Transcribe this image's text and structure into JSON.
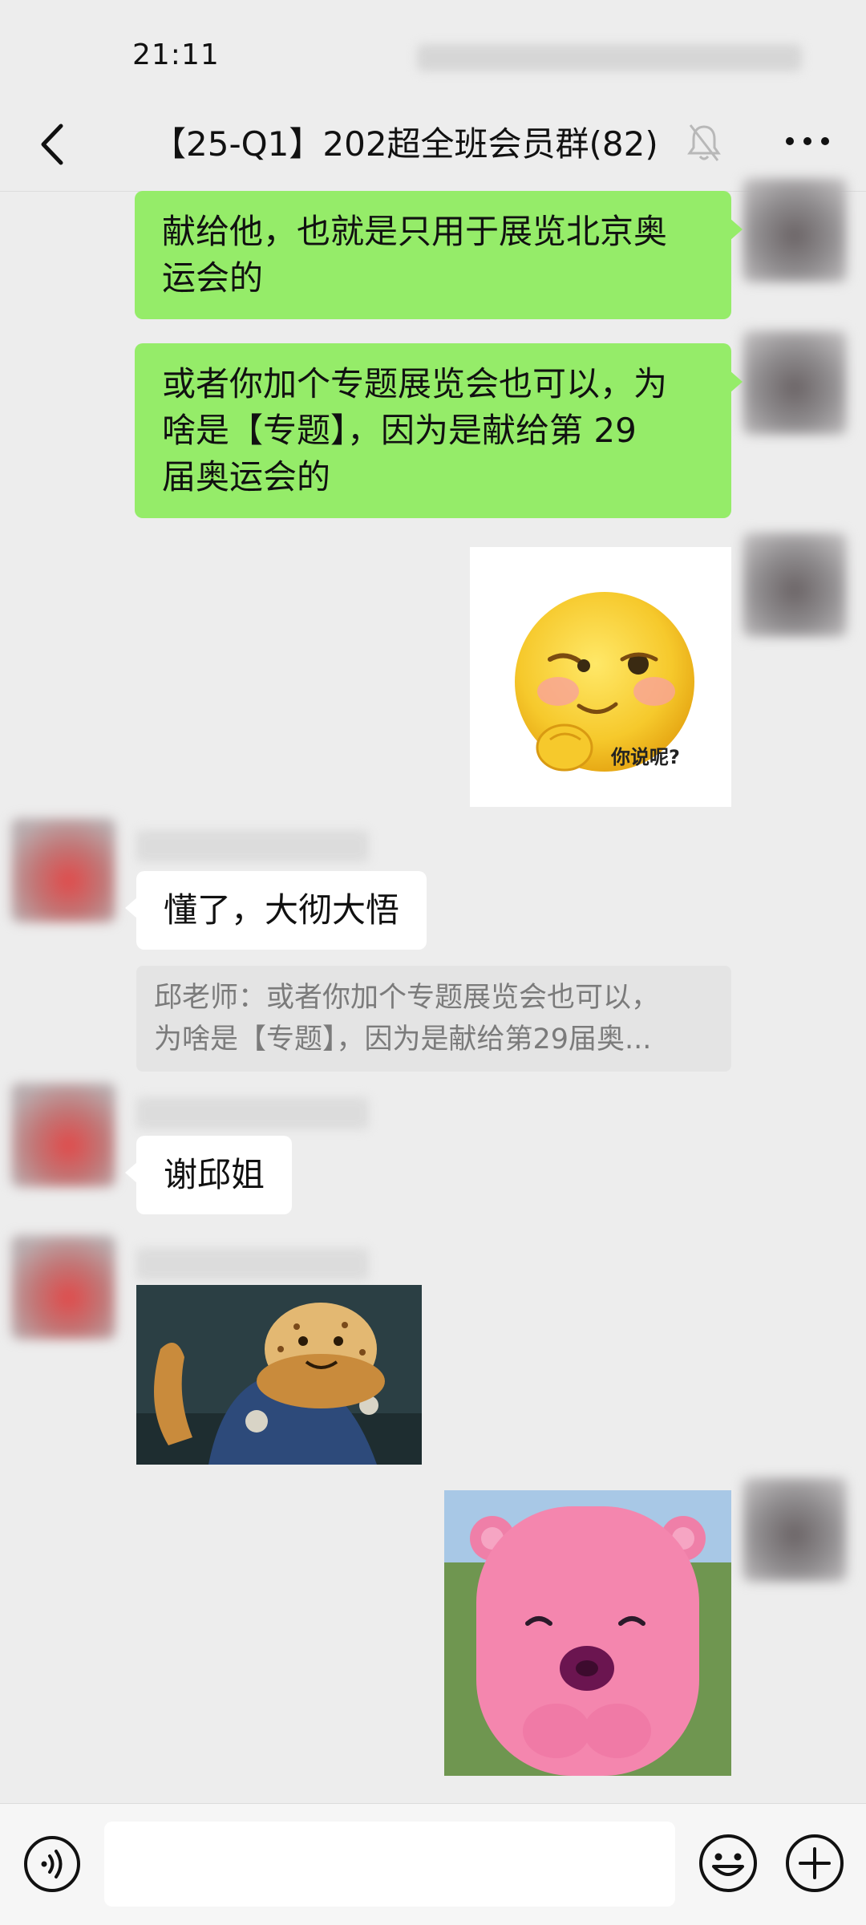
{
  "status": {
    "time": "21:11"
  },
  "header": {
    "title": "【25-Q1】202超全班会员群(82)"
  },
  "messages": {
    "m1": {
      "line1": "献给他，也就是只用于展览北京奥",
      "line2": "运会的"
    },
    "m2": {
      "line1": "或者你加个专题展览会也可以，为",
      "line2": "啥是【专题】，因为是献给第 29",
      "line3": "届奥运会的"
    },
    "m3": {
      "sticker_caption": "你说呢?"
    },
    "m4": {
      "text": "懂了，大彻大悟",
      "quote_line1": "邱老师：或者你加个专题展览会也可以，",
      "quote_line2": "为啥是【专题】，因为是献给第29届奥..."
    },
    "m5": {
      "text": "谢邱姐"
    }
  },
  "input": {
    "placeholder": ""
  },
  "colors": {
    "self_bubble": "#95ec69",
    "other_bubble": "#ffffff",
    "background": "#ededed"
  },
  "icons": [
    "back-arrow-icon",
    "mute-bell-icon",
    "more-dots-icon",
    "voice-icon",
    "emoji-icon",
    "plus-icon"
  ]
}
